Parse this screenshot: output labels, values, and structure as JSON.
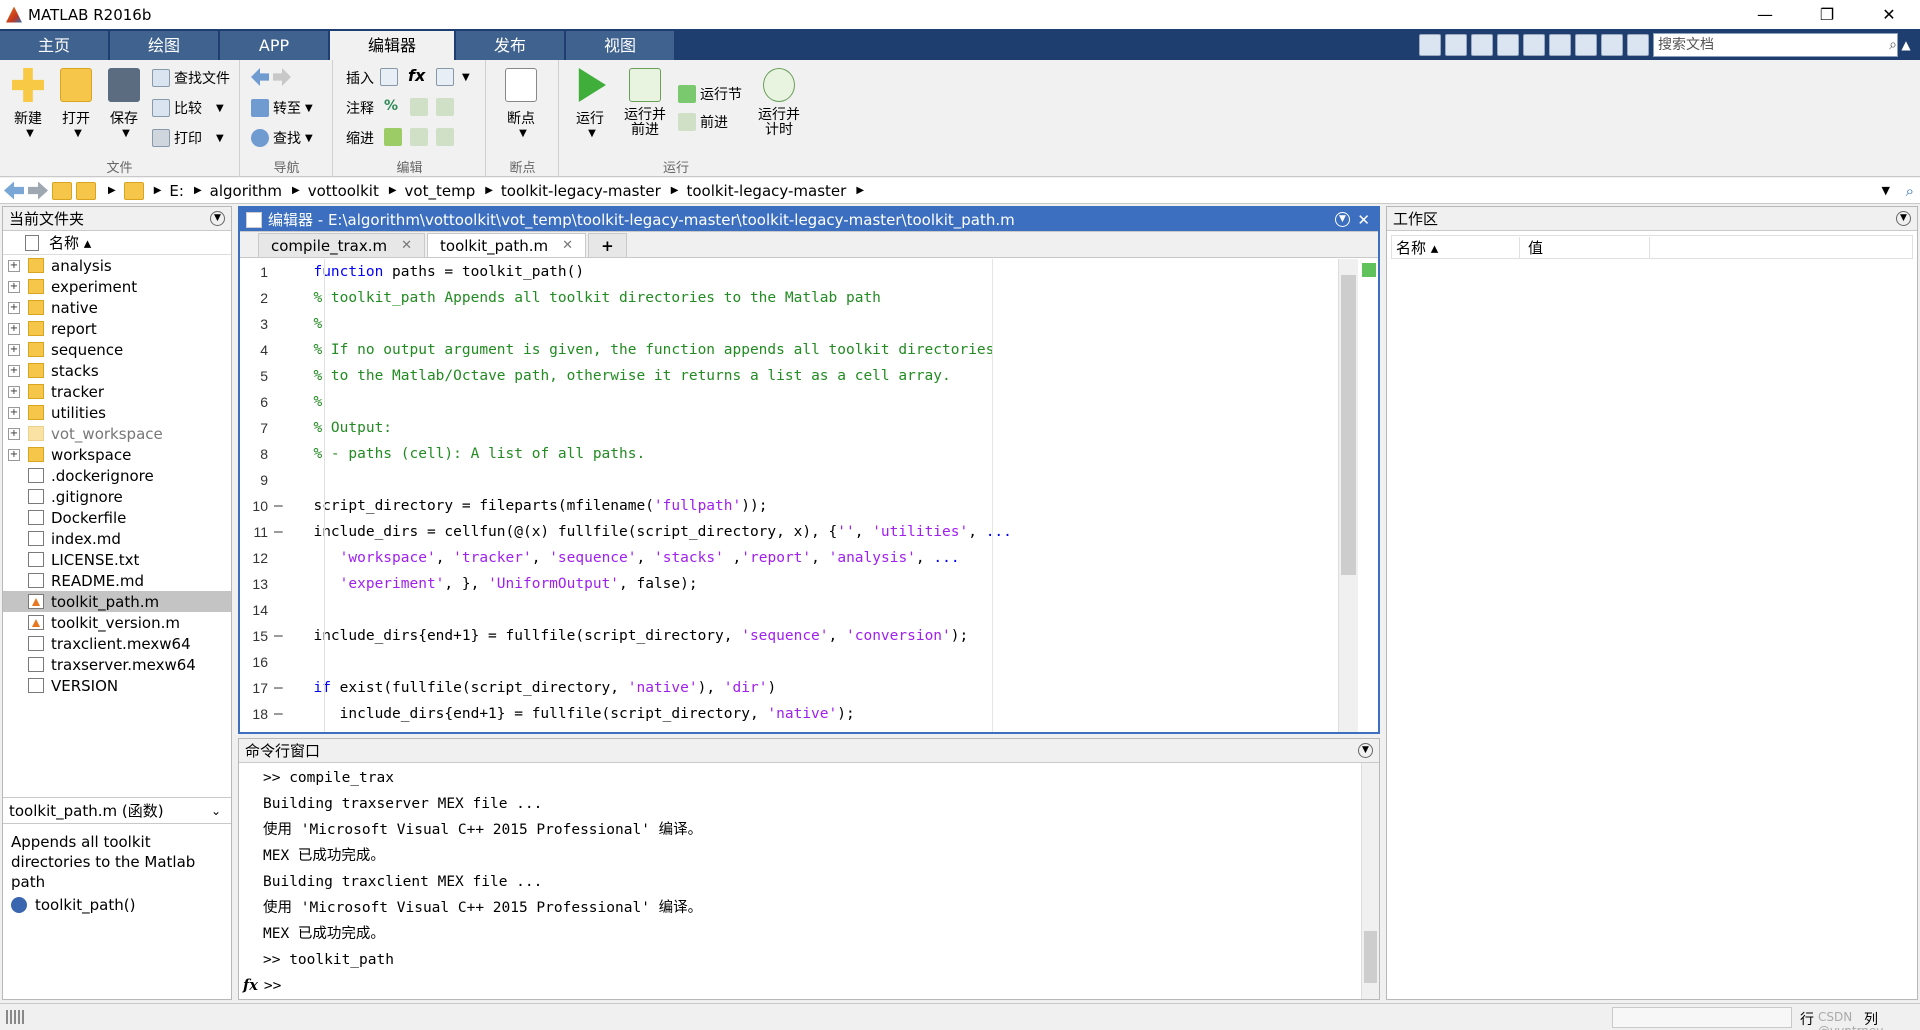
{
  "window": {
    "title": "MATLAB R2016b",
    "minimize": "—",
    "restore": "❐",
    "close": "✕"
  },
  "tabs": [
    "主页",
    "绘图",
    "APP",
    "编辑器",
    "发布",
    "视图"
  ],
  "search": {
    "placeholder": "搜索文档"
  },
  "ribbon": {
    "file": {
      "label": "文件",
      "new": "新建",
      "open": "打开",
      "save": "保存",
      "find_files": "查找文件",
      "compare": "比较",
      "print": "打印"
    },
    "navigate": {
      "label": "导航",
      "goto": "转至",
      "find": "查找"
    },
    "edit": {
      "label": "编辑",
      "insert": "插入",
      "comment": "注释",
      "indent": "缩进",
      "fx": "fx"
    },
    "breakpoints": {
      "label": "断点",
      "button": "断点"
    },
    "run": {
      "label": "运行",
      "run": "运行",
      "run_advance_l1": "运行并",
      "run_advance_l2": "前进",
      "run_section": "运行节",
      "advance": "前进",
      "run_time_l1": "运行并",
      "run_time_l2": "计时"
    }
  },
  "address": {
    "drive": "E:",
    "parts": [
      "algorithm",
      "vottoolkit",
      "vot_temp",
      "toolkit-legacy-master",
      "toolkit-legacy-master"
    ]
  },
  "current_folder": {
    "title": "当前文件夹",
    "col_name": "名称 ▴",
    "items": [
      {
        "name": "analysis",
        "kind": "folder"
      },
      {
        "name": "experiment",
        "kind": "folder"
      },
      {
        "name": "native",
        "kind": "folder"
      },
      {
        "name": "report",
        "kind": "folder"
      },
      {
        "name": "sequence",
        "kind": "folder"
      },
      {
        "name": "stacks",
        "kind": "folder"
      },
      {
        "name": "tracker",
        "kind": "folder"
      },
      {
        "name": "utilities",
        "kind": "folder"
      },
      {
        "name": "vot_workspace",
        "kind": "folder"
      },
      {
        "name": "workspace",
        "kind": "folder"
      },
      {
        "name": ".dockerignore",
        "kind": "doc"
      },
      {
        "name": ".gitignore",
        "kind": "doc"
      },
      {
        "name": "Dockerfile",
        "kind": "doc"
      },
      {
        "name": "index.md",
        "kind": "doc"
      },
      {
        "name": "LICENSE.txt",
        "kind": "doc"
      },
      {
        "name": "README.md",
        "kind": "doc"
      },
      {
        "name": "toolkit_path.m",
        "kind": "m"
      },
      {
        "name": "toolkit_version.m",
        "kind": "m"
      },
      {
        "name": "traxclient.mexw64",
        "kind": "doc"
      },
      {
        "name": "traxserver.mexw64",
        "kind": "doc"
      },
      {
        "name": "VERSION",
        "kind": "doc"
      }
    ],
    "selected": "toolkit_path.m",
    "details_title": "toolkit_path.m  (函数)",
    "details_desc": "Appends all toolkit directories to the Matlab path",
    "details_func": "toolkit_path()"
  },
  "editor": {
    "title": "编辑器 - E:\\algorithm\\vottoolkit\\vot_temp\\toolkit-legacy-master\\toolkit-legacy-master\\toolkit_path.m",
    "tabs": [
      "compile_trax.m",
      "toolkit_path.m"
    ],
    "add_tab": "+",
    "lines": [
      "1",
      "2",
      "3",
      "4",
      "5",
      "6",
      "7",
      "8",
      "9",
      "10",
      "11",
      "12",
      "13",
      "14",
      "15",
      "16",
      "17",
      "18"
    ]
  },
  "command_window": {
    "title": "命令行窗口",
    "lines": [
      ">> compile_trax",
      "Building traxserver MEX file ...",
      "使用 'Microsoft Visual C++ 2015 Professional' 编译。",
      "MEX 已成功完成。",
      "Building traxclient MEX file ...",
      "使用 'Microsoft Visual C++ 2015 Professional' 编译。",
      "MEX 已成功完成。",
      ">> toolkit_path"
    ],
    "prompt": ">>",
    "fx": "fx"
  },
  "workspace": {
    "title": "工作区",
    "col_name": "名称 ▴",
    "col_value": "值"
  },
  "status": {
    "row": "行",
    "col": "列",
    "watermark": "CSDN @vvptrney"
  }
}
